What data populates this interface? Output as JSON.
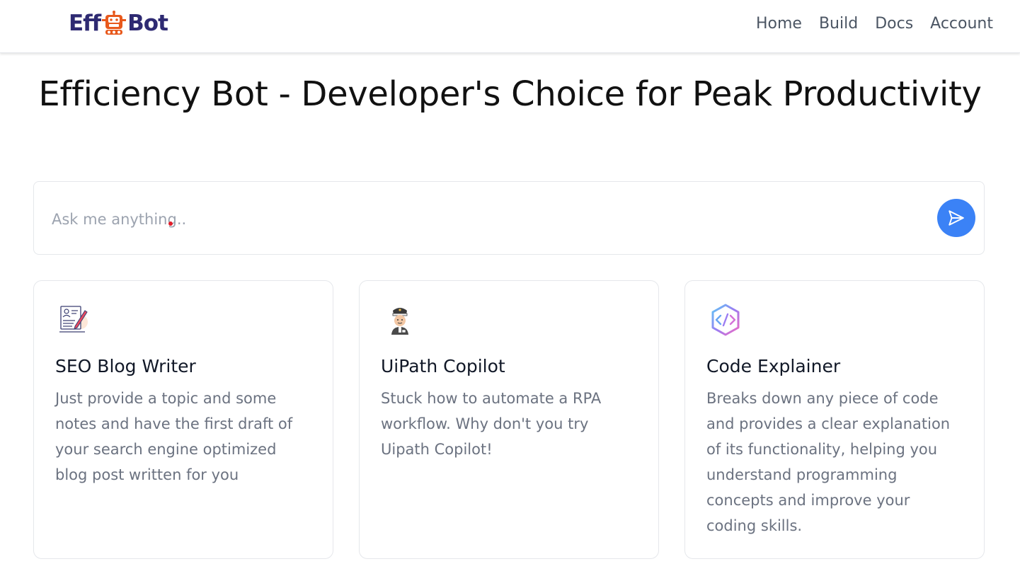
{
  "header": {
    "logo": {
      "left": "Eff",
      "right": "Bot"
    },
    "nav": [
      "Home",
      "Build",
      "Docs",
      "Account"
    ]
  },
  "hero": {
    "title": "Efficiency Bot - Developer's Choice for Peak Productivity"
  },
  "search": {
    "placeholder": "Ask me anything..",
    "send_icon": "paper-plane-icon"
  },
  "cards": [
    {
      "icon": "blog-writer-icon",
      "title": "SEO Blog Writer",
      "description": "Just provide a topic and some notes and have the first draft of your search engine optimized blog post written for you"
    },
    {
      "icon": "pilot-avatar-icon",
      "title": "UiPath Copilot",
      "description": "Stuck how to automate a RPA workflow. Why don't you try Uipath Copilot!"
    },
    {
      "icon": "code-hexagon-icon",
      "title": "Code Explainer",
      "description": "Breaks down any piece of code and provides a clear explanation of its functionality, helping you understand programming concepts and improve your coding skills."
    }
  ],
  "colors": {
    "brand": "#2e2a72",
    "robot": "#e8591c",
    "accent": "#3b82f6",
    "muted_text": "#6b7280"
  }
}
